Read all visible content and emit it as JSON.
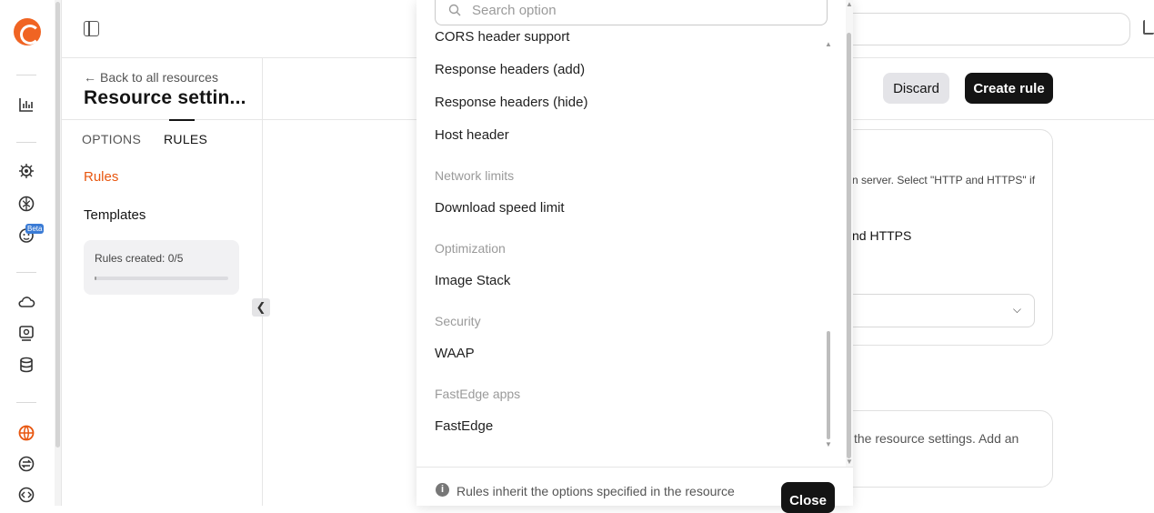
{
  "rail": {
    "icons": [
      "logo-icon",
      "analytics-icon",
      "chip-icon",
      "brain-icon",
      "robot-icon",
      "cloud-icon",
      "monitor-icon",
      "database-icon",
      "globe-icon",
      "exchange-icon",
      "code-icon"
    ],
    "beta_label": "Beta"
  },
  "header": {
    "back_label": "Back to all resources",
    "resource_title": "Resource settin...",
    "discard_label": "Discard",
    "create_rule_label": "Create rule"
  },
  "sub_nav": {
    "tabs": [
      {
        "label": "OPTIONS",
        "active": false
      },
      {
        "label": "RULES",
        "active": true
      }
    ],
    "items": [
      {
        "label": "Rules",
        "active": true
      },
      {
        "label": "Templates",
        "active": false
      }
    ],
    "rules_created": "Rules created: 0/5",
    "rules_progress": 0.0
  },
  "dropdown": {
    "search_placeholder": "Search option",
    "partial_item": "CORS header support",
    "items": [
      {
        "type": "item",
        "label": "Response headers (add)"
      },
      {
        "type": "item",
        "label": "Response headers (hide)"
      },
      {
        "type": "item",
        "label": "Host header"
      },
      {
        "type": "group",
        "label": "Network limits"
      },
      {
        "type": "item",
        "label": "Download speed limit"
      },
      {
        "type": "group",
        "label": "Optimization"
      },
      {
        "type": "item",
        "label": "Image Stack"
      },
      {
        "type": "group",
        "label": "Security"
      },
      {
        "type": "item",
        "label": "WAAP"
      },
      {
        "type": "group",
        "label": "FastEdge apps"
      },
      {
        "type": "item",
        "label": "FastEdge"
      }
    ],
    "footer_text": "Rules inherit the options specified in the resource",
    "close_label": "Close"
  },
  "background": {
    "card1_text": "n server. Select \"HTTP and HTTPS\" if",
    "card1_radio": "nd HTTPS",
    "card2_text": "the resource settings. Add an"
  },
  "colors": {
    "accent": "#e8560f",
    "dark_button": "#141414",
    "secondary_button": "#e4e4e8"
  }
}
